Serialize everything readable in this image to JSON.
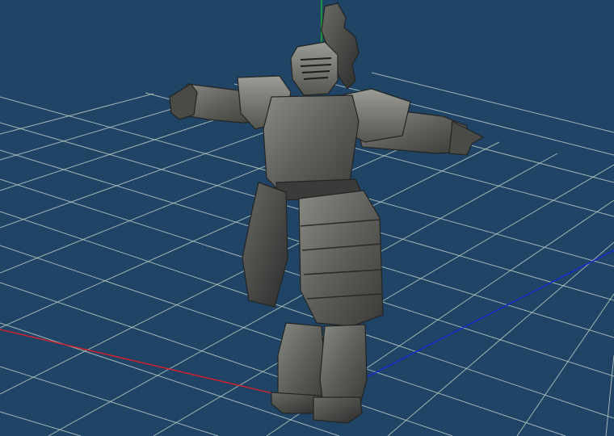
{
  "viewport": {
    "background_color": "#1f4466",
    "grid_color": "#b8c9c0",
    "axis_colors": {
      "x": "#d81f2a",
      "y": "#1fb02a",
      "z": "#1428d8"
    },
    "grid_visible": true,
    "axes_visible": true
  },
  "model": {
    "kind": "armored knight in T-pose",
    "pose": "t-pose",
    "material_color": "#6a6a66"
  }
}
